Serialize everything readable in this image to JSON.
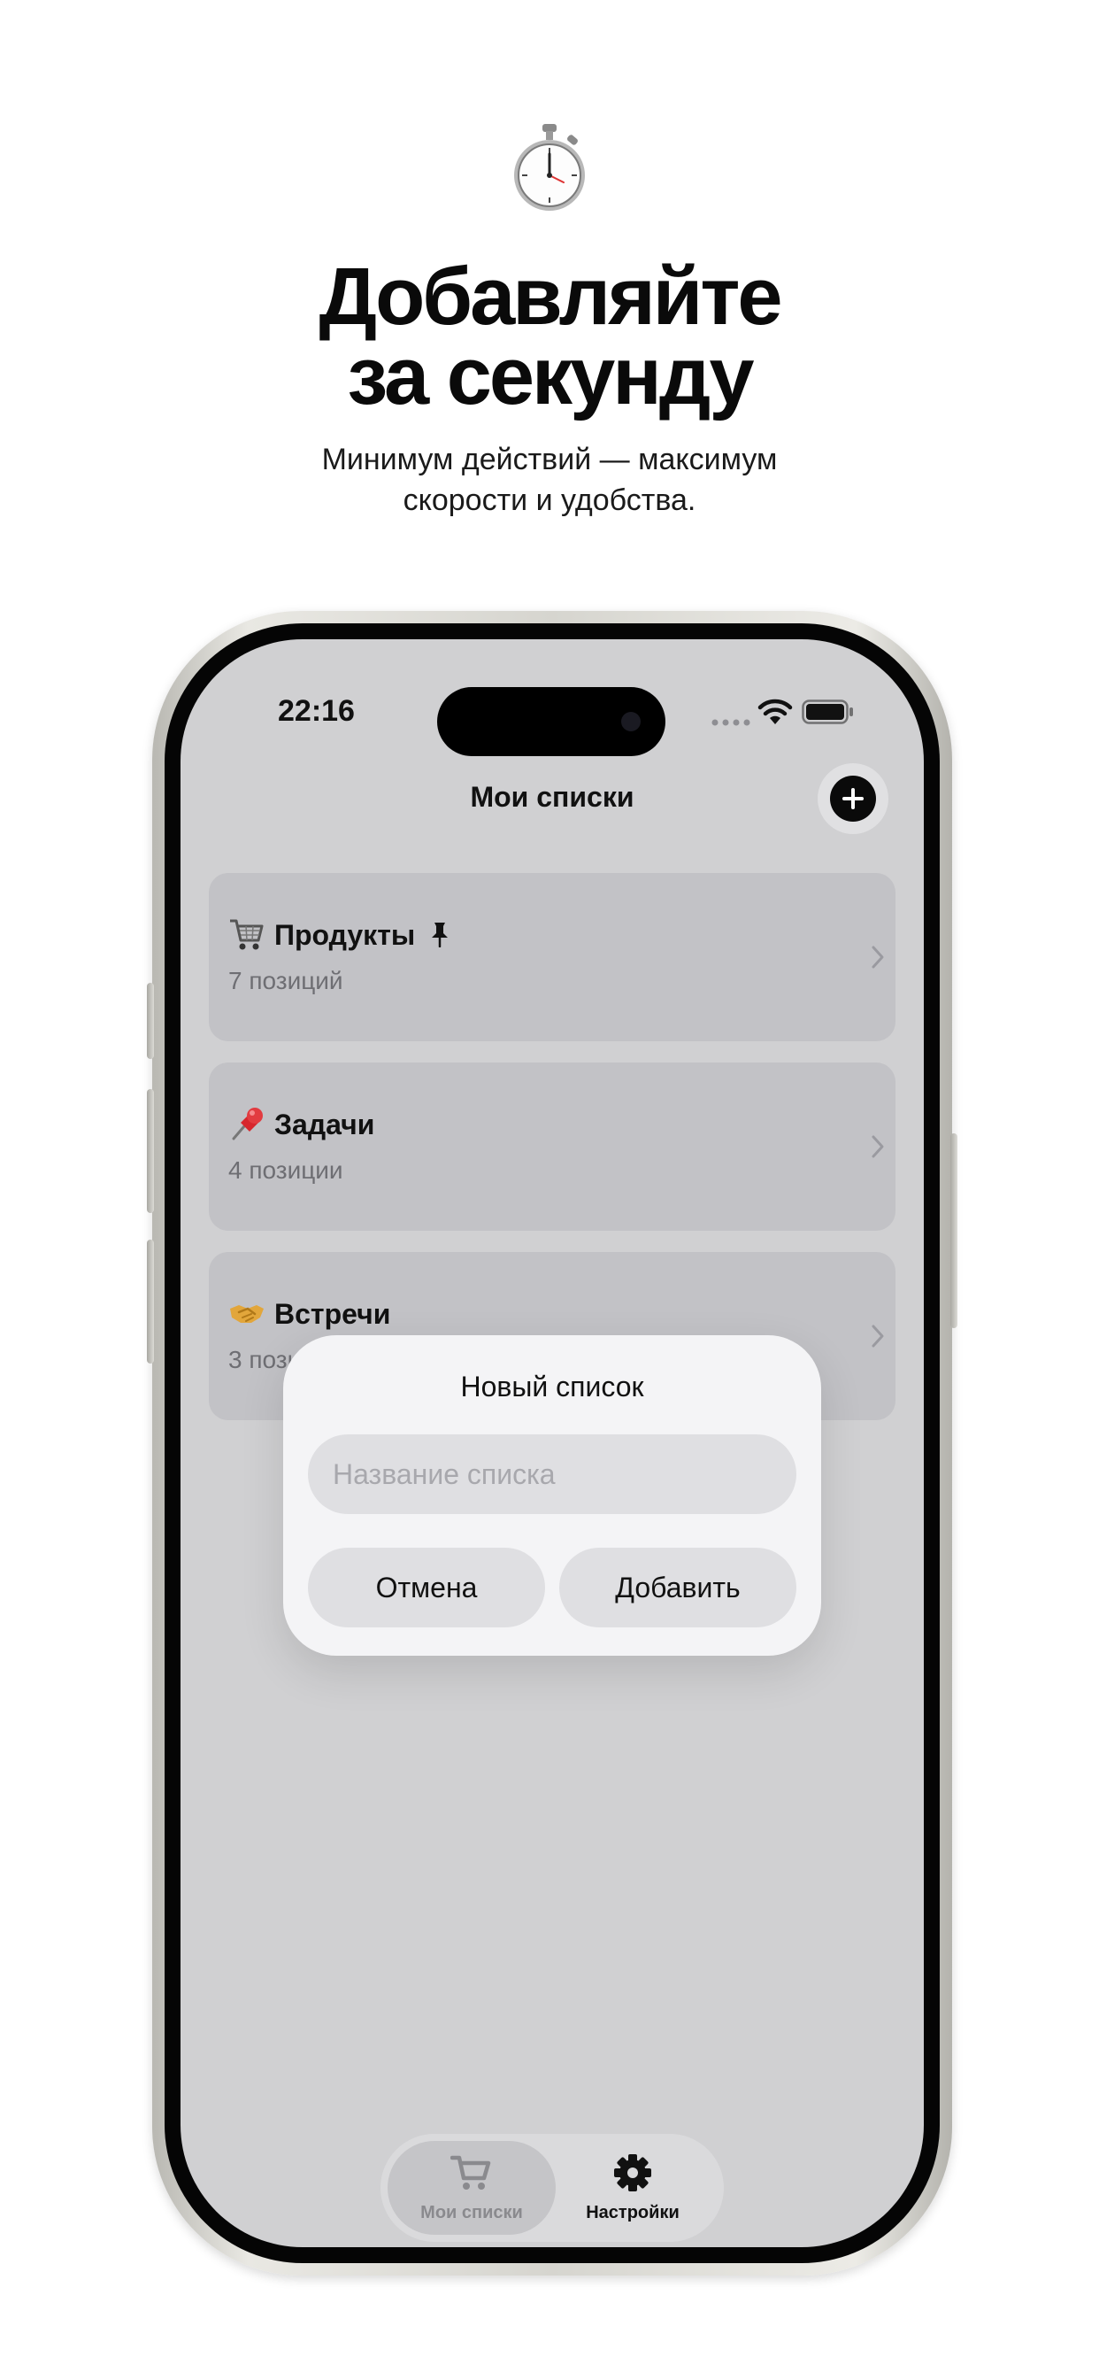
{
  "promo": {
    "headline_line1": "Добавляйте",
    "headline_line2": "за секунду",
    "subline_line1": "Минимум действий — максимум",
    "subline_line2": "скорости и удобства.",
    "hero_icon": "stopwatch-icon"
  },
  "status_bar": {
    "time": "22:16"
  },
  "nav": {
    "title": "Мои списки",
    "add_icon": "plus-icon"
  },
  "lists": [
    {
      "title": "Продукты",
      "count": "7 позиций",
      "icon": "shopping-cart-icon",
      "pinned": true
    },
    {
      "title": "Задачи",
      "count": "4 позиции",
      "icon": "pushpin-icon",
      "pinned": false
    },
    {
      "title": "Встречи",
      "count": "3 позиции",
      "icon": "handshake-icon",
      "pinned": false
    }
  ],
  "dialog": {
    "title": "Новый список",
    "input_placeholder": "Название списка",
    "input_value": "",
    "cancel_label": "Отмена",
    "add_label": "Добавить"
  },
  "tabbar": {
    "tabs": [
      {
        "label": "Мои списки",
        "icon": "cart-icon",
        "active": true
      },
      {
        "label": "Настройки",
        "icon": "gear-icon",
        "active": false
      }
    ]
  },
  "colors": {
    "screen_background": "#d0d0d2",
    "card_background": "#c2c2c6",
    "dialog_background": "#f4f4f6",
    "accent_dark": "#0a0a0a",
    "secondary_text": "#6e6e73"
  }
}
